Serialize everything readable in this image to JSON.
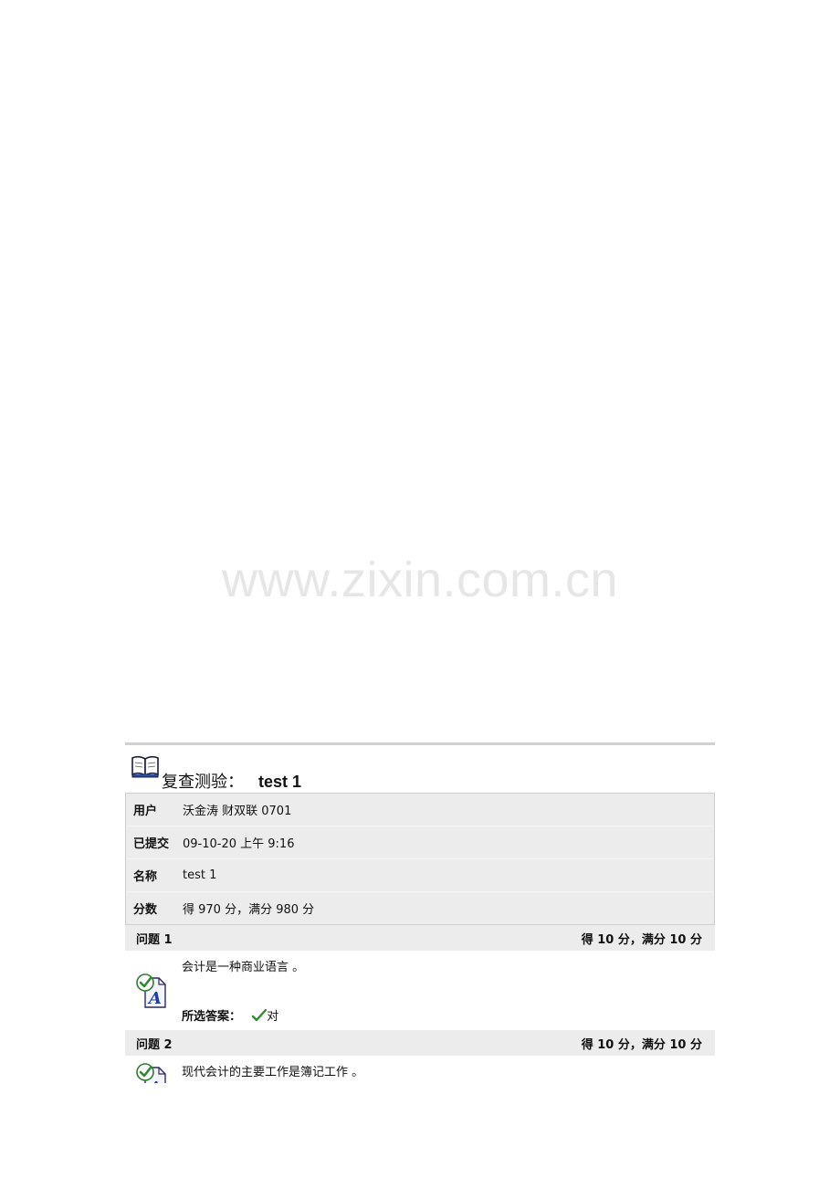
{
  "watermark": "www.zixin.com.cn",
  "header": {
    "label": "复查测验：",
    "test_name": "test 1"
  },
  "info": [
    {
      "key": "用户",
      "value": "沃金涛 财双联 0701"
    },
    {
      "key": "已提交",
      "value": "09-10-20 上午 9:16"
    },
    {
      "key": "名称",
      "value": "test 1"
    },
    {
      "key": "分数",
      "value": "得  970  分，满分  980  分"
    }
  ],
  "questions": [
    {
      "title": "问题  1",
      "score": "得  10  分，满分  10  分",
      "text": "会计是一种商业语言  。",
      "answer_label": "所选答案：",
      "answer_value": "对"
    },
    {
      "title": "问题  2",
      "score": "得  10  分，满分  10  分",
      "text": "现代会计的主要工作是簿记工作  。"
    }
  ],
  "icons": {
    "header": "open-book-icon",
    "question": "correct-answer-icon",
    "answer": "checkmark-icon"
  },
  "colors": {
    "header_bg": "#ececec",
    "check": "#2e8b2e",
    "watermark": "#e6e6e6"
  }
}
